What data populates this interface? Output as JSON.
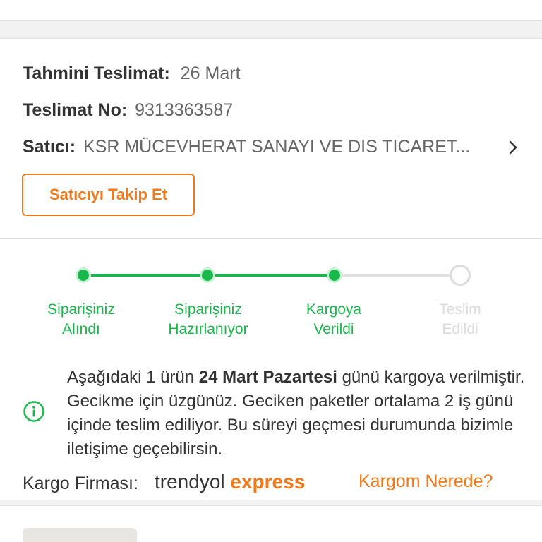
{
  "delivery": {
    "estimated_label": "Tahmini Teslimat:",
    "estimated_value": "26 Mart",
    "number_label": "Teslimat No:",
    "number_value": "9313363587",
    "seller_label": "Satıcı:",
    "seller_value": "KSR MÜCEVHERAT SANAYI VE DIS TICARET..."
  },
  "follow_button": "Satıcıyı Takip Et",
  "steps": [
    {
      "line1": "Siparişiniz",
      "line2": "Alındı",
      "done": true
    },
    {
      "line1": "Siparişiniz",
      "line2": "Hazırlanıyor",
      "done": true
    },
    {
      "line1": "Kargoya",
      "line2": "Verildi",
      "done": true
    },
    {
      "line1": "Teslim",
      "line2": "Edildi",
      "done": false
    }
  ],
  "notice": {
    "part1": "Aşağıdaki 1 ürün ",
    "bold": "24 Mart Pazartesi",
    "part2": " günü kargoya verilmiştir. Gecikme için üzgünüz. Geciken paketler ortalama 2 iş günü içinde teslim ediliyor. Bu süreyi geçmesi durumunda bizimle iletişime geçebilirsin."
  },
  "cargo": {
    "label": "Kargo Firması:",
    "brand_part1": "trendyol",
    "brand_part2": "express",
    "where_link": "Kargom Nerede?"
  },
  "colors": {
    "accent_orange": "#f27a1a",
    "progress_green": "#19b84a",
    "inactive_gray": "#dcdcdc"
  },
  "icons": {
    "seller_chevron": "chevron-right-icon",
    "notice": "info-circle-icon"
  }
}
